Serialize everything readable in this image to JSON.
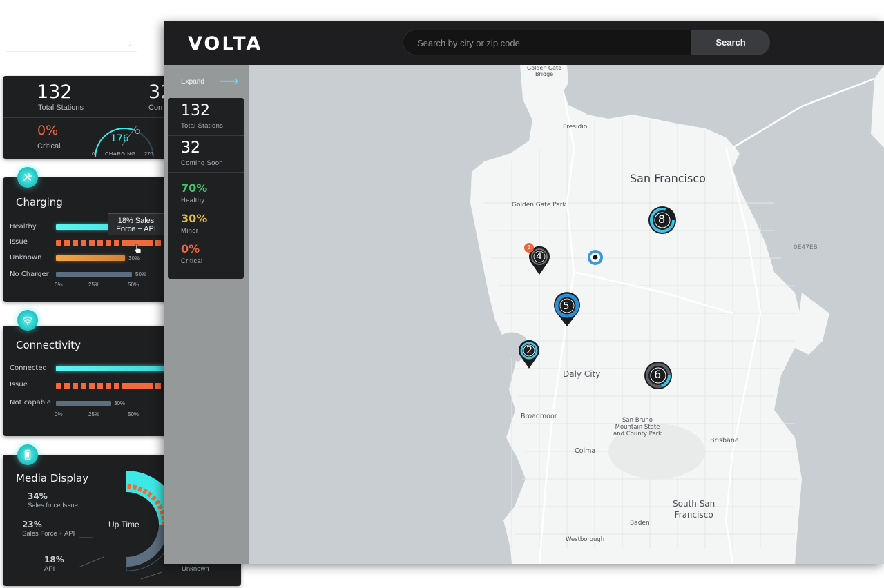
{
  "overview_card": {
    "total_stations": "132",
    "total_stations_label": "Total Stations",
    "coming_partial": "32",
    "coming_label_partial": "Con",
    "critical_pct": "0%",
    "critical_label": "Critical",
    "gauge_value": "176",
    "gauge_label": "CHARGING",
    "gauge_min": "0",
    "gauge_max": "270",
    "gauge_fraction": 0.65
  },
  "charging_card": {
    "title": "Charging",
    "rows": [
      {
        "label": "Healthy"
      },
      {
        "label": "Issue"
      },
      {
        "label": "Unknown",
        "pct": "30%"
      },
      {
        "label": "No Charger",
        "pct": "50%"
      }
    ],
    "axis": [
      "0%",
      "25%",
      "50%"
    ],
    "tooltip": "18% Sales\nForce + API"
  },
  "connectivity_card": {
    "title": "Connectivity",
    "rows": [
      {
        "label": "Connected"
      },
      {
        "label": "Issue"
      },
      {
        "label": "Not capable",
        "pct": "30%"
      }
    ],
    "axis": [
      "0%",
      "25%",
      "50%"
    ]
  },
  "media_card": {
    "title": "Media Display",
    "center_label": "Up Time",
    "segments": [
      {
        "pct": "34%",
        "label": "Sales force Issue"
      },
      {
        "pct": "23%",
        "label": "Sales Force + API"
      },
      {
        "pct": "18%",
        "label": "API"
      }
    ],
    "unknown_label": "Unknown"
  },
  "header": {
    "logo": "VOLTA",
    "search_placeholder": "Search by city or zip code",
    "search_button": "Search"
  },
  "sidebar": {
    "expand_label": "Expand",
    "stats": [
      {
        "value": "132",
        "label": "Total Stations",
        "color": "#ffffff"
      },
      {
        "value": "32",
        "label": "Coming Soon",
        "color": "#ffffff"
      },
      {
        "value": "70%",
        "label": "Healthy",
        "color": "#3fc46a"
      },
      {
        "value": "30%",
        "label": "Minor",
        "color": "#e8b73c"
      },
      {
        "value": "0%",
        "label": "Critical",
        "color": "#f0643a"
      }
    ]
  },
  "map": {
    "labels": {
      "golden_gate_bridge": "Golden Gate\nBridge",
      "presidio": "Presidio",
      "san_francisco": "San Francisco",
      "golden_gate_park": "Golden Gate Park",
      "daly_city": "Daly City",
      "broadmoor": "Broadmoor",
      "san_bruno": "San Bruno\nMountain State\nand County Park",
      "brisbane": "Brisbane",
      "colma": "Colma",
      "south_sf": "South San\nFrancisco",
      "baden": "Baden",
      "westborough": "Westborough",
      "hex_code": "0E47EB"
    },
    "pins": [
      {
        "count": "8",
        "style": "cluster"
      },
      {
        "count": "4",
        "badge": "3",
        "style": "pin"
      },
      {
        "count": "5",
        "style": "pin-blue"
      },
      {
        "count": "2",
        "style": "pin"
      },
      {
        "count": "6",
        "style": "cluster"
      }
    ]
  },
  "colors": {
    "accent_cyan": "#3ee8e4",
    "issue_orange": "#f26a3b",
    "unknown_amber": "#f2a64a",
    "app_bar": "#1e1e20"
  }
}
